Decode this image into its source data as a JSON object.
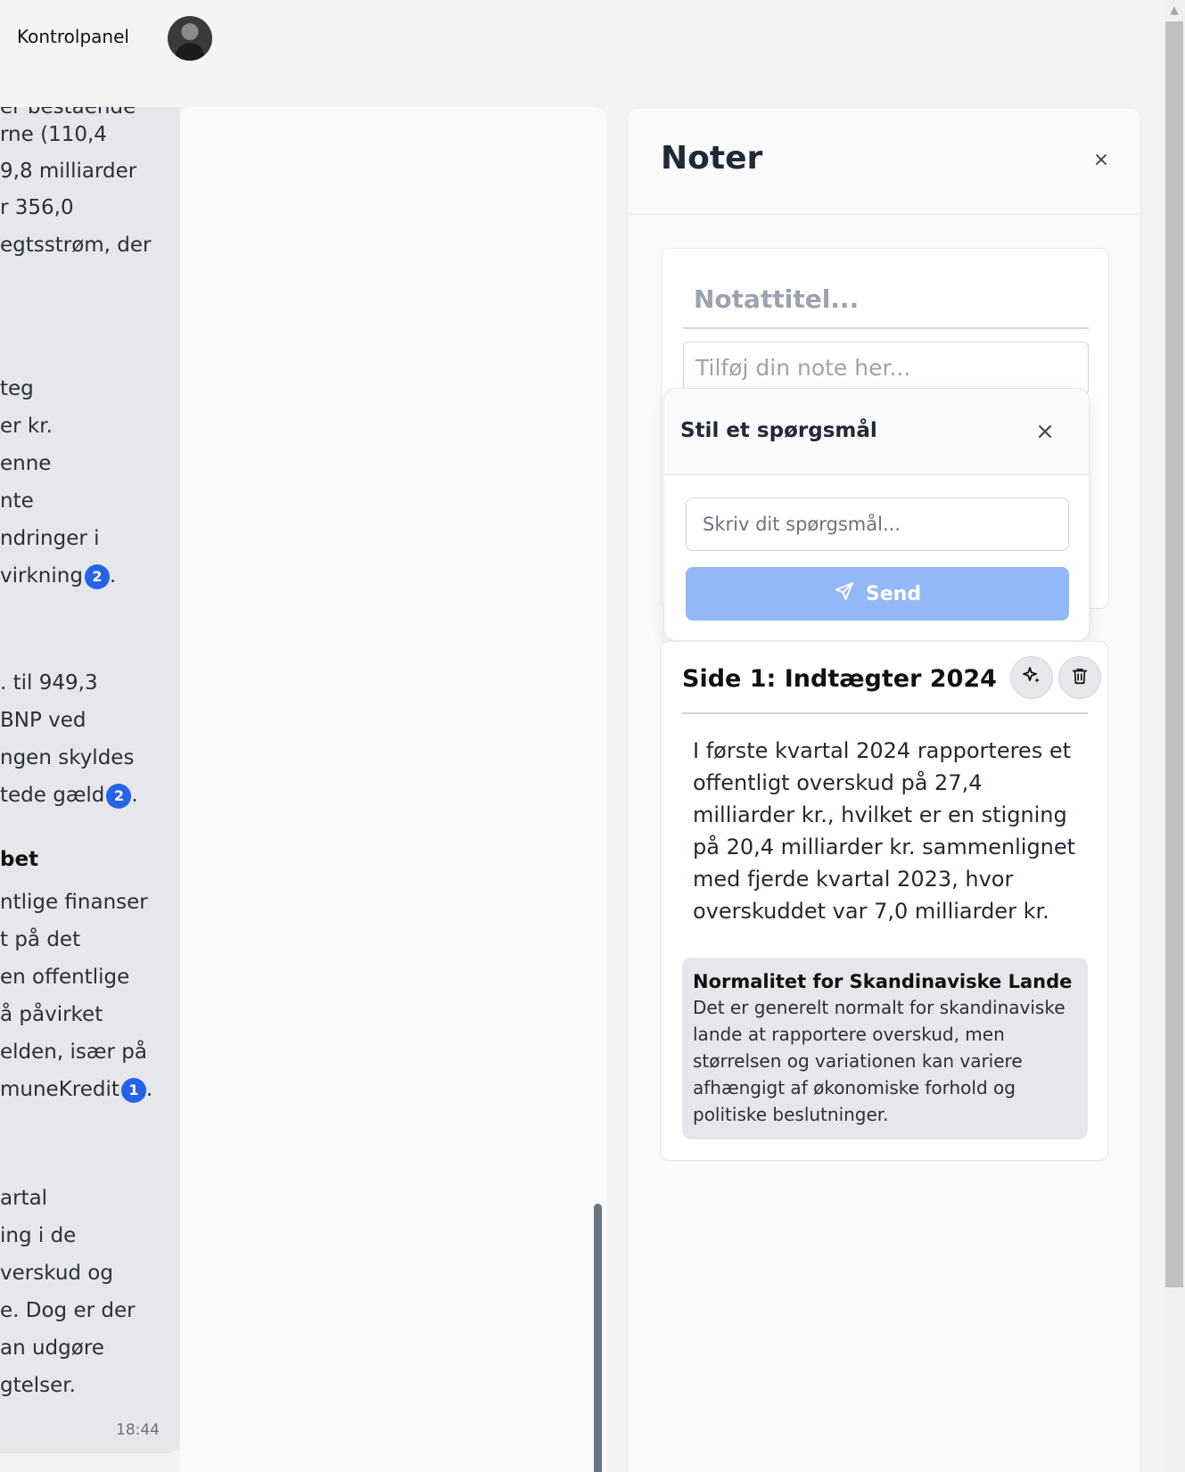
{
  "header": {
    "title": "Kontrolpanel"
  },
  "chat": {
    "lines": [
      "er bestående",
      "rne (110,4",
      "9,8 milliarder",
      "r 356,0",
      "egtsstrøm, der",
      "teg",
      "er kr.",
      "enne",
      "nte",
      "ndringer i",
      "virkning",
      ". til 949,3",
      "BNP ved",
      "ngen skyldes",
      "tede gæld",
      "bet",
      "ntlige finanser",
      "t på det",
      "en offentlige",
      "å påvirket",
      "elden, især på",
      "muneKredit",
      "artal",
      "ing i de",
      "verskud og",
      "e. Dog er der",
      "an udgøre",
      "gtelser."
    ],
    "badges": {
      "b1": "2",
      "b2": "2",
      "b3": "1"
    },
    "time": "18:44"
  },
  "notes": {
    "title": "Noter",
    "close_icon": "close-icon",
    "new_note": {
      "title_placeholder": "Notattitel...",
      "body_placeholder": "Tilføj din note her..."
    },
    "ask": {
      "title": "Stil et spørgsmål",
      "input_placeholder": "Skriv dit spørgsmål...",
      "send_label": "Send"
    },
    "card": {
      "title": "Side 1: Indtægter 2024",
      "body": "I første kvartal 2024 rapporteres et offentligt overskud på 27,4 milliarder kr., hvilket er en stigning på 20,4 milliarder kr. sammenlignet med fjerde kvartal 2023, hvor overskuddet var 7,0 milliarder kr.",
      "answer_title": "Normalitet for Skandinaviske Lande",
      "answer_text": "Det er generelt normalt for skandinaviske lande at rapportere overskud, men størrelsen og variationen kan variere afhængigt af økonomiske forhold og politiske beslutninger."
    }
  },
  "colors": {
    "accent": "#2563eb",
    "send_button": "#93b8f8"
  }
}
